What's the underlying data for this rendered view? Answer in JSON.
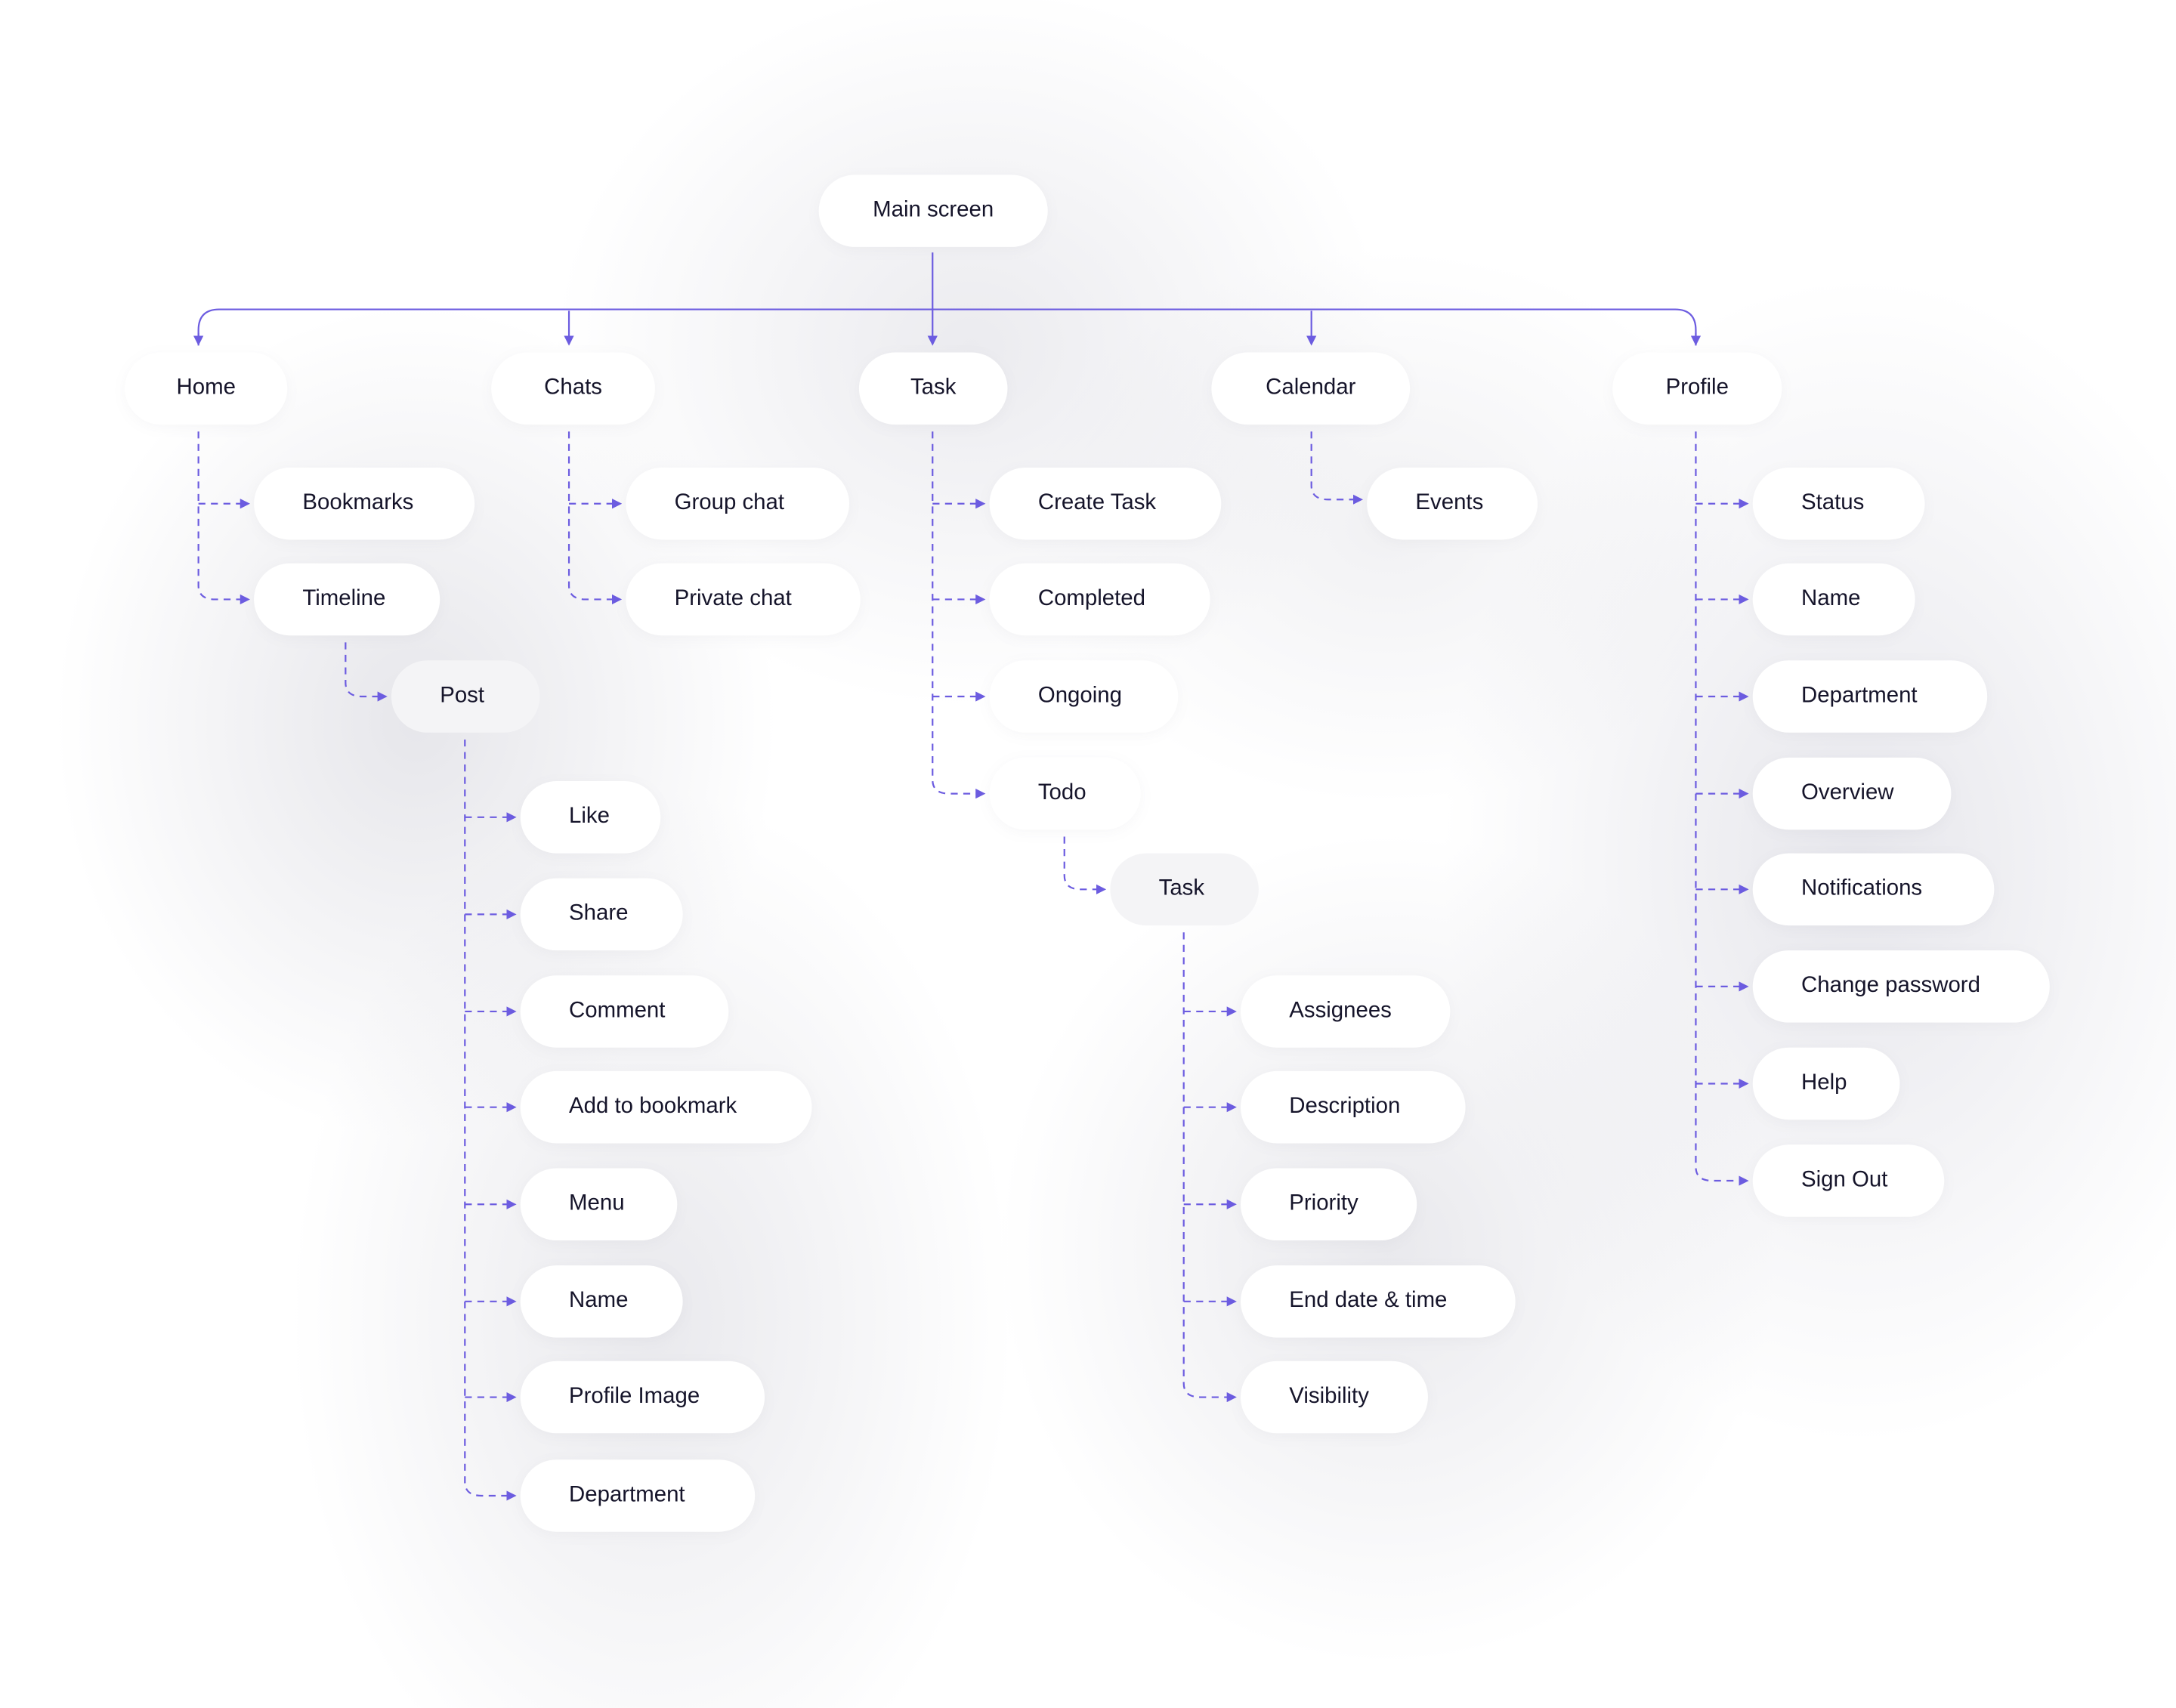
{
  "colors": {
    "line": "#6c5ce0",
    "text": "#15142a",
    "node": "#ffffff"
  },
  "root": {
    "label": "Main screen"
  },
  "sections": [
    {
      "label": "Home",
      "children": [
        {
          "label": "Bookmarks"
        },
        {
          "label": "Timeline",
          "children": [
            {
              "label": "Post",
              "children": [
                {
                  "label": "Like"
                },
                {
                  "label": "Share"
                },
                {
                  "label": "Comment"
                },
                {
                  "label": "Add to bookmark"
                },
                {
                  "label": "Menu"
                },
                {
                  "label": "Name"
                },
                {
                  "label": "Profile Image"
                },
                {
                  "label": "Department"
                }
              ]
            }
          ]
        }
      ]
    },
    {
      "label": "Chats",
      "children": [
        {
          "label": "Group chat"
        },
        {
          "label": "Private chat"
        }
      ]
    },
    {
      "label": "Task",
      "children": [
        {
          "label": "Create Task"
        },
        {
          "label": "Completed"
        },
        {
          "label": "Ongoing"
        },
        {
          "label": "Todo",
          "children": [
            {
              "label": "Task",
              "children": [
                {
                  "label": "Assignees"
                },
                {
                  "label": "Description"
                },
                {
                  "label": "Priority"
                },
                {
                  "label": "End date & time"
                },
                {
                  "label": "Visibility"
                }
              ]
            }
          ]
        }
      ]
    },
    {
      "label": "Calendar",
      "children": [
        {
          "label": "Events"
        }
      ]
    },
    {
      "label": "Profile",
      "children": [
        {
          "label": "Status"
        },
        {
          "label": "Name"
        },
        {
          "label": "Department"
        },
        {
          "label": "Overview"
        },
        {
          "label": "Notifications"
        },
        {
          "label": "Change password"
        },
        {
          "label": "Help"
        },
        {
          "label": "Sign Out"
        }
      ]
    }
  ]
}
